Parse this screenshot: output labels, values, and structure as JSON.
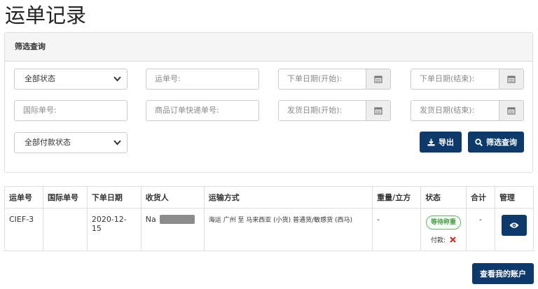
{
  "page": {
    "title": "运单记录"
  },
  "filter": {
    "heading": "筛选查询",
    "status_select": "全部状态",
    "waybill_placeholder": "运单号:",
    "order_date_start": "下单日期(开始):",
    "order_date_end": "下单日期(结束):",
    "intl_no_placeholder": "国际单号:",
    "express_no_placeholder": "商品订单快递单号:",
    "ship_date_start": "发货日期(开始):",
    "ship_date_end": "发货日期(结束):",
    "payment_select": "全部付款状态",
    "export_label": "导出",
    "search_label": "筛选查询"
  },
  "table": {
    "headers": {
      "waybill": "运单号",
      "intl_no": "国际单号",
      "order_date": "下单日期",
      "receiver": "收货人",
      "transport": "运输方式",
      "weight": "重量/立方",
      "status": "状态",
      "total": "合计",
      "manage": "管理"
    },
    "rows": [
      {
        "waybill": "CIEF-3",
        "intl_no": "",
        "order_date": "2020-12-15",
        "receiver": "Na",
        "transport": "海运 广州 至 马来西亚 (小货) 普通货/敏感货 (西马)",
        "weight": "-",
        "status": "等待称重",
        "payment_label": "付款:",
        "total": "-"
      }
    ]
  },
  "footer": {
    "account_label": "查看我的账户"
  },
  "colors": {
    "primary": "#0e3a6b",
    "status_green": "#5cb85c",
    "unpaid_red": "#c9302c"
  }
}
